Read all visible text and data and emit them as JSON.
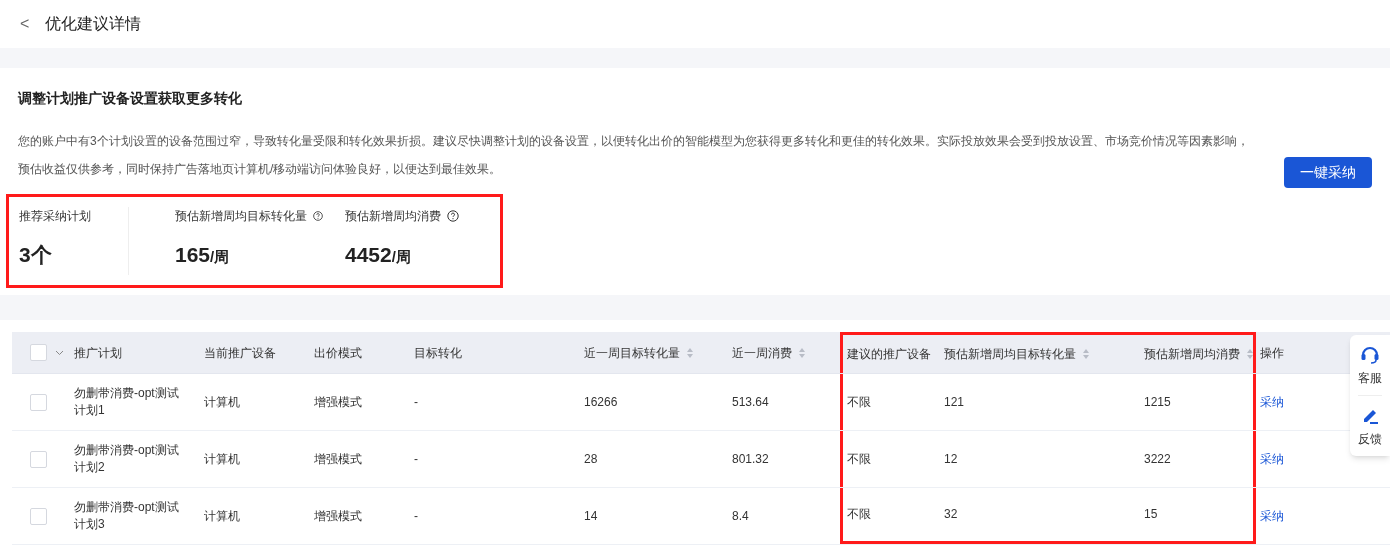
{
  "header": {
    "back": "<",
    "title": "优化建议详情"
  },
  "suggestion": {
    "title": "调整计划推广设备设置获取更多转化",
    "description": "您的账户中有3个计划设置的设备范围过窄，导致转化量受限和转化效果折损。建议尽快调整计划的设备设置，以便转化出价的智能模型为您获得更多转化和更佳的转化效果。实际投放效果会受到投放设置、市场竞价情况等因素影响，预估收益仅供参考，同时保持广告落地页计算机/移动端访问体验良好，以便达到最佳效果。",
    "button": "一键采纳"
  },
  "summary": {
    "highlighted": true,
    "stats": [
      {
        "label": "推荐采纳计划",
        "value": "3个",
        "help": false
      },
      {
        "label": "预估新增周均目标转化量",
        "value": "165",
        "unit": "/周",
        "help": true
      },
      {
        "label": "预估新增周均消费",
        "value": "4452",
        "unit": "/周",
        "help": true
      }
    ]
  },
  "table": {
    "select_all": {
      "checked": false
    },
    "columns": [
      {
        "label": "推广计划",
        "sortable": false,
        "highlighted": false
      },
      {
        "label": "当前推广设备",
        "sortable": false,
        "highlighted": false
      },
      {
        "label": "出价模式",
        "sortable": false,
        "highlighted": false
      },
      {
        "label": "目标转化",
        "sortable": false,
        "highlighted": false
      },
      {
        "label": "近一周目标转化量",
        "sortable": true,
        "highlighted": false
      },
      {
        "label": "近一周消费",
        "sortable": true,
        "highlighted": false
      },
      {
        "label": "建议的推广设备",
        "sortable": false,
        "highlighted": true
      },
      {
        "label": "预估新增周均目标转化量",
        "sortable": true,
        "highlighted": true
      },
      {
        "label": "预估新增周均消费",
        "sortable": true,
        "highlighted": true
      },
      {
        "label": "操作",
        "sortable": false,
        "highlighted": false
      }
    ],
    "rows": [
      {
        "checked": false,
        "cells": [
          "勿删带消费-opt测试计划1",
          "计算机",
          "增强模式",
          "-",
          "16266",
          "513.64",
          "不限",
          "121",
          "1215"
        ],
        "action": "采纳"
      },
      {
        "checked": false,
        "cells": [
          "勿删带消费-opt测试计划2",
          "计算机",
          "增强模式",
          "-",
          "28",
          "801.32",
          "不限",
          "12",
          "3222"
        ],
        "action": "采纳"
      },
      {
        "checked": false,
        "cells": [
          "勿删带消费-opt测试计划3",
          "计算机",
          "增强模式",
          "-",
          "14",
          "8.4",
          "不限",
          "32",
          "15"
        ],
        "action": "采纳"
      }
    ]
  },
  "side_widget": [
    {
      "kind": "service",
      "label": "客服"
    },
    {
      "kind": "feedback",
      "label": "反馈"
    }
  ]
}
